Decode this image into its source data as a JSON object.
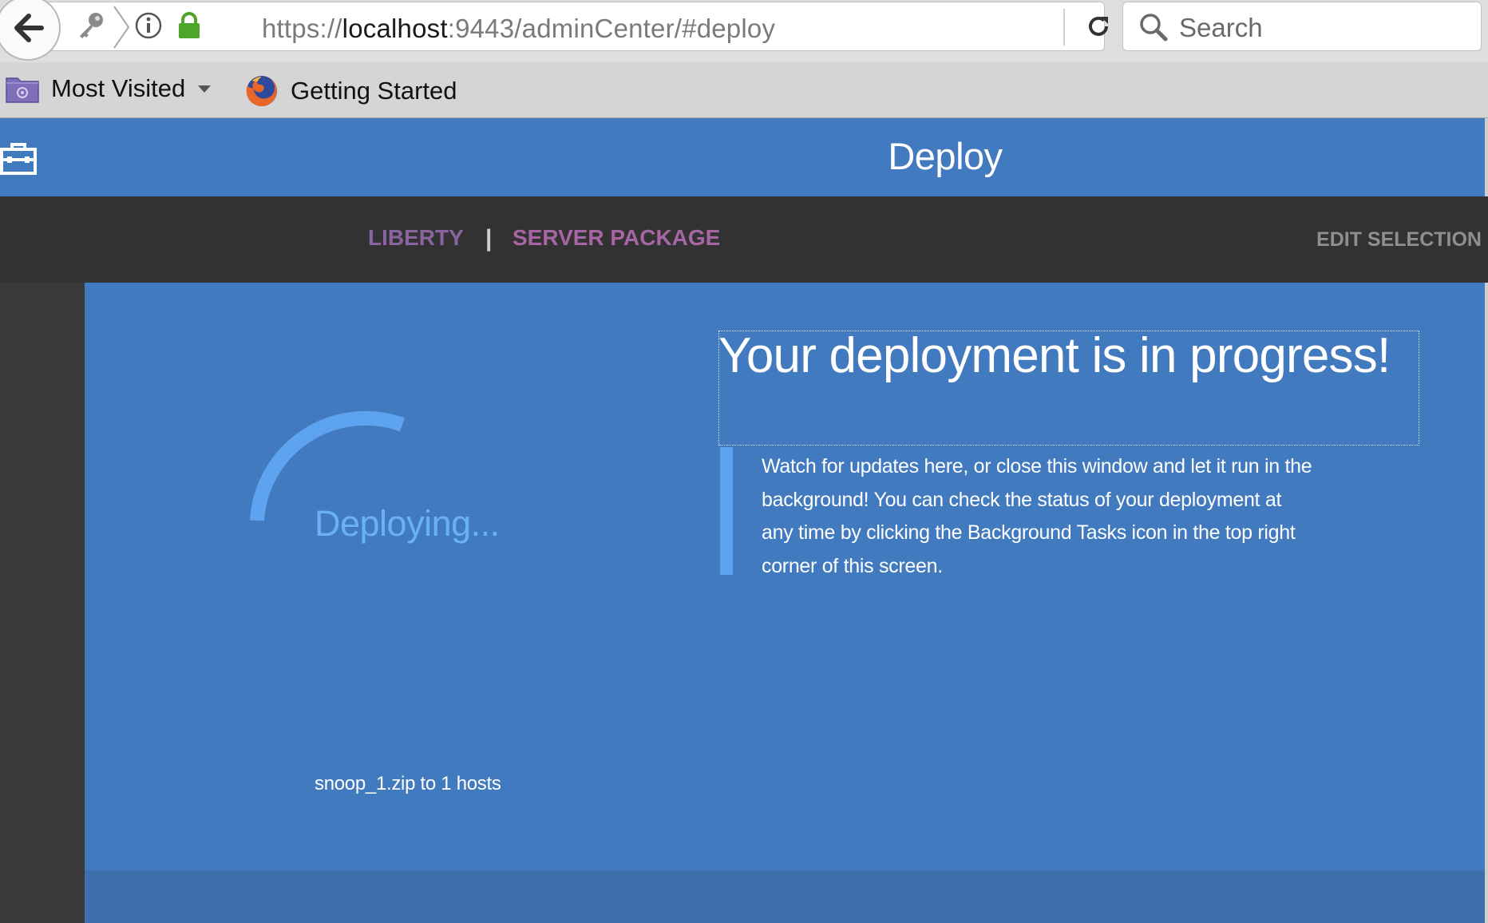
{
  "browser": {
    "url_scheme": "https://",
    "url_host": "localhost",
    "url_rest": ":9443/adminCenter/#deploy",
    "search_placeholder": "Search",
    "bookmarks": [
      {
        "label": "Most Visited",
        "icon": "folder-icon",
        "has_dropdown": true
      },
      {
        "label": "Getting Started",
        "icon": "firefox-icon"
      }
    ]
  },
  "header": {
    "title": "Deploy",
    "icon": "toolbox-icon"
  },
  "subnav": {
    "crumbs": [
      "LIBERTY",
      "SERVER PACKAGE"
    ],
    "separator": "|",
    "edit_selection": "EDIT SELECTION"
  },
  "deployment": {
    "spinner_label": "Deploying...",
    "status": "snoop_1.zip to 1 hosts",
    "headline": "Your deployment is in progress!",
    "message": "Watch for updates here, or close this window and let it run in the background! You can check the status of your deployment at any time by clicking the Background Tasks icon in the top right corner of this screen."
  },
  "colors": {
    "header_blue": "#427abf",
    "subnav_dark": "#323232",
    "crumb_liberty": "#8a64a0",
    "crumb_package": "#a765a4",
    "spinner": "#5ea3f0",
    "deploying_text": "#6ab0f5"
  }
}
